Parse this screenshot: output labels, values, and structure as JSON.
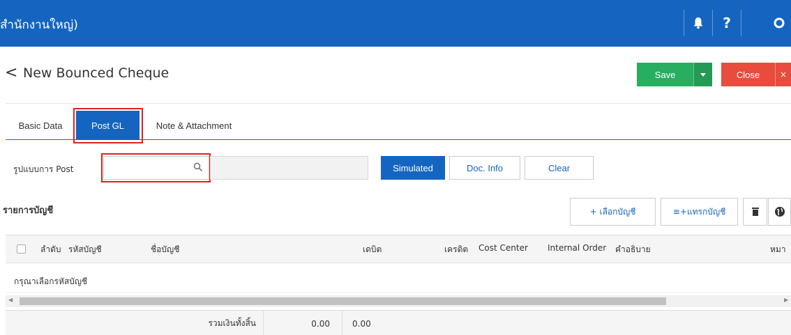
{
  "header": {
    "title": "สำนักงานใหญ่)",
    "icons": [
      "bell-icon",
      "help-icon",
      "settings-icon"
    ]
  },
  "page": {
    "back_symbol": "<",
    "title": "New Bounced Cheque",
    "save_label": "Save",
    "close_label": "Close",
    "close_x": "×"
  },
  "tabs": [
    {
      "label": "Basic Data",
      "active": false
    },
    {
      "label": "Post GL",
      "active": true
    },
    {
      "label": "Note & Attachment",
      "active": false
    }
  ],
  "post": {
    "format_label": "รูปแบบการ Post",
    "format_value": "",
    "simulated_label": "Simulated",
    "docinfo_label": "Doc. Info",
    "clear_label": "Clear"
  },
  "accounts": {
    "section_title": "รายการบัญชี",
    "select_account_label": "+ เลือกบัญชี",
    "insert_account_label": "≡+แทรกบัญชี",
    "columns": {
      "seq": "ลำดับ",
      "code": "รหัสบัญชี",
      "name": "ชื่อบัญชี",
      "debit": "เดบิต",
      "credit": "เครดิต",
      "cost_center": "Cost Center",
      "internal_order": "Internal Order",
      "description": "คำอธิบาย",
      "remark": "หมา"
    },
    "empty_message": "กรุณาเลือกรหัสบัญชี",
    "total_label": "รวมเงินทั้งสิ้น",
    "total_debit": "0.00",
    "total_credit": "0.00"
  },
  "colors": {
    "primary": "#1565c0",
    "save": "#27ae60",
    "close": "#e74c3c",
    "highlight": "#e02020"
  }
}
